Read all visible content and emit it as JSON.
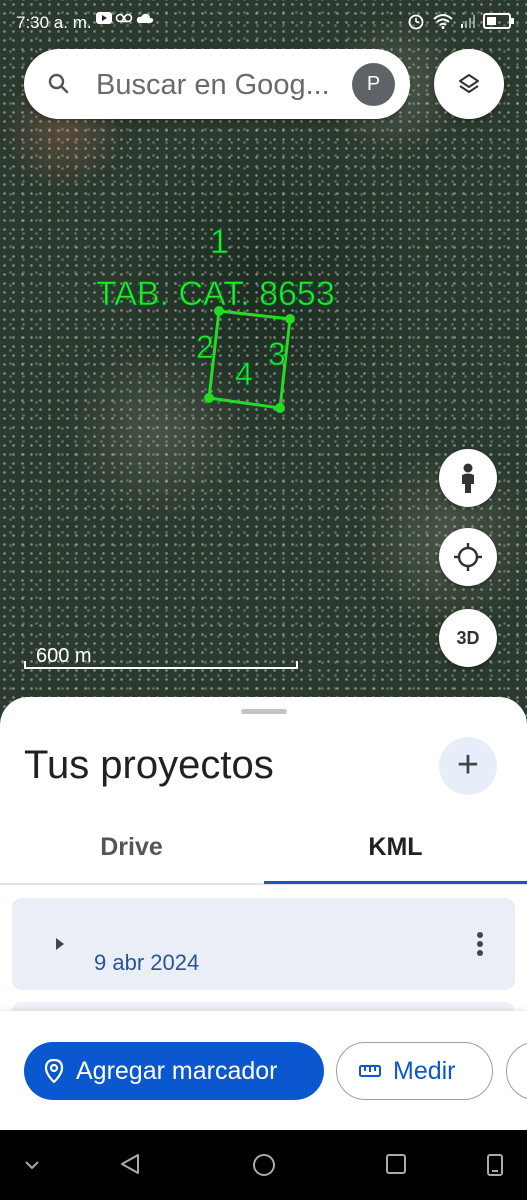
{
  "status_bar": {
    "time": "7:30 a. m."
  },
  "search": {
    "placeholder": "Buscar en Goog...",
    "avatar_letter": "P"
  },
  "map": {
    "labels": {
      "title": "TAB. CAT. 8653",
      "p1": "1",
      "p2": "2",
      "p3": "3",
      "p4": "4"
    },
    "scale_label": "600 m",
    "three_d_label": "3D",
    "overlay_color": "#22dd22"
  },
  "sheet": {
    "title": "Tus proyectos",
    "tabs": [
      {
        "label": "Drive"
      },
      {
        "label": "KML"
      }
    ],
    "active_tab": "KML",
    "projects": [
      {
        "date": "9 abr 2024"
      }
    ]
  },
  "actions": {
    "add_marker": "Agregar marcador",
    "measure": "Medir"
  },
  "colors": {
    "accent": "#0b57d0",
    "card": "#e9eef7",
    "date_text": "#2a5594"
  },
  "icons": [
    "search-icon",
    "layers-icon",
    "pegman-icon",
    "my-location-icon",
    "plus-icon",
    "chevron-right-icon",
    "more-vert-icon",
    "place-icon",
    "ruler-icon"
  ]
}
